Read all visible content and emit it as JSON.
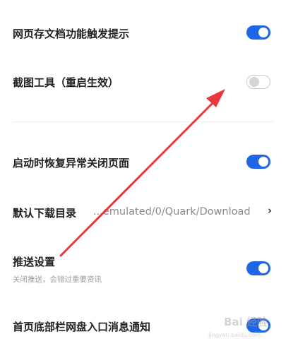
{
  "settings": [
    {
      "label": "网页存文档功能触发提示",
      "toggle": "on"
    },
    {
      "label": "截图工具（重启生效）",
      "toggle": "off"
    },
    {
      "label": "启动时恢复异常关闭页面",
      "toggle": "on"
    },
    {
      "label": "默认下载目录",
      "value": "...emulated/0/Quark/Download",
      "chevron": "›"
    },
    {
      "label": "推送设置",
      "sublabel": "关闭推送，会错过重要资讯",
      "toggle": "on"
    },
    {
      "label": "首页底部栏网盘入口消息通知",
      "toggle": "on"
    }
  ],
  "annotation": {
    "arrow_color": "#e8383d"
  },
  "watermark": {
    "text": "Bai 经验",
    "sub": "jingyan.baidu.com"
  }
}
